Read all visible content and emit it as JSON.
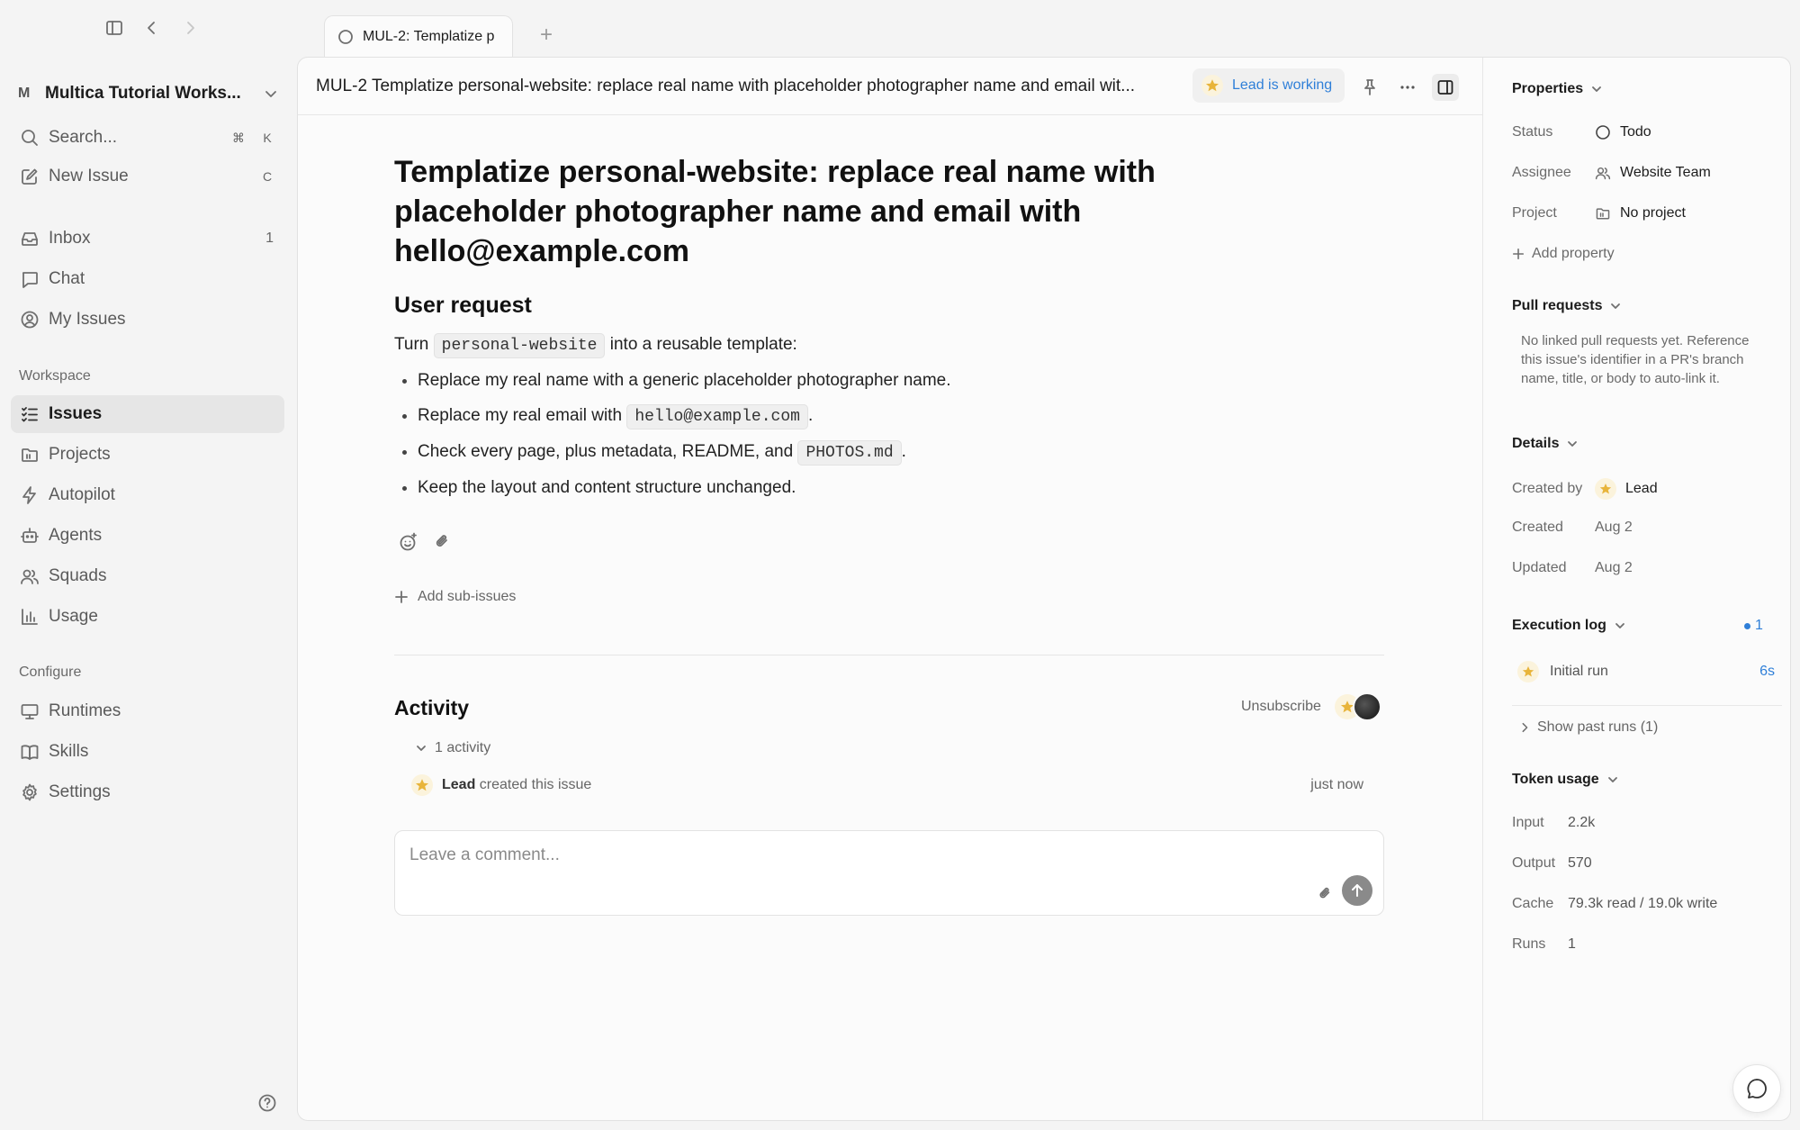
{
  "tab": {
    "label": "MUL-2: Templatize p",
    "new_tab": "+"
  },
  "sidebar": {
    "workspace_badge": "M",
    "workspace_name": "Multica Tutorial Works...",
    "search_label": "Search...",
    "search_kbd_1": "⌘",
    "search_kbd_2": "K",
    "new_issue_label": "New Issue",
    "new_issue_kbd": "C",
    "items": [
      {
        "label": "Inbox",
        "count": "1"
      },
      {
        "label": "Chat"
      },
      {
        "label": "My Issues"
      }
    ],
    "workspace_header": "Workspace",
    "workspace_items": [
      {
        "label": "Issues"
      },
      {
        "label": "Projects"
      },
      {
        "label": "Autopilot"
      },
      {
        "label": "Agents"
      },
      {
        "label": "Squads"
      },
      {
        "label": "Usage"
      }
    ],
    "configure_header": "Configure",
    "configure_items": [
      {
        "label": "Runtimes"
      },
      {
        "label": "Skills"
      },
      {
        "label": "Settings"
      }
    ]
  },
  "topbar": {
    "title": "MUL-2 Templatize personal-website: replace real name with placeholder photographer name and email wit...",
    "status": "Lead is working"
  },
  "issue": {
    "title": "Templatize personal-website: replace real name with placeholder photographer name and email with hello@example.com",
    "section_heading": "User request",
    "intro_before": "Turn",
    "intro_code": "personal-website",
    "intro_after": "into a reusable template:",
    "bullets": {
      "b1": "Replace my real name with a generic placeholder photographer name.",
      "b2_before": "Replace my real email with",
      "b2_code": "hello@example.com",
      "b2_after": ".",
      "b3_before": "Check every page, plus metadata, README, and",
      "b3_code": "PHOTOS.md",
      "b3_after": ".",
      "b4": "Keep the layout and content structure unchanged."
    },
    "add_sub_issues": "Add sub-issues"
  },
  "activity": {
    "heading": "Activity",
    "unsubscribe": "Unsubscribe",
    "count": "1 activity",
    "actor": "Lead",
    "action": "created this issue",
    "time": "just now",
    "comment_placeholder": "Leave a comment..."
  },
  "properties": {
    "header": "Properties",
    "status_key": "Status",
    "status_val": "Todo",
    "assignee_key": "Assignee",
    "assignee_val": "Website Team",
    "project_key": "Project",
    "project_val": "No project",
    "add_property": "Add property",
    "pr_header": "Pull requests",
    "pr_note": "No linked pull requests yet. Reference this issue's identifier in a PR's branch name, title, or body to auto-link it.",
    "details_header": "Details",
    "created_by_key": "Created by",
    "created_by_val": "Lead",
    "created_key": "Created",
    "created_val": "Aug 2",
    "updated_key": "Updated",
    "updated_val": "Aug 2",
    "exec_header": "Execution log",
    "exec_count": "1",
    "run_label": "Initial run",
    "run_time": "6s",
    "past_runs": "Show past runs (1)",
    "token_header": "Token usage",
    "input_key": "Input",
    "input_val": "2.2k",
    "output_key": "Output",
    "output_val": "570",
    "cache_key": "Cache",
    "cache_val": "79.3k read / 19.0k write",
    "runs_key": "Runs",
    "runs_val": "1"
  },
  "colors": {
    "accent": "#2f7fd8",
    "background": "#f4f4f4",
    "panel": "#fbfbfb",
    "star": "#e8b43a"
  }
}
